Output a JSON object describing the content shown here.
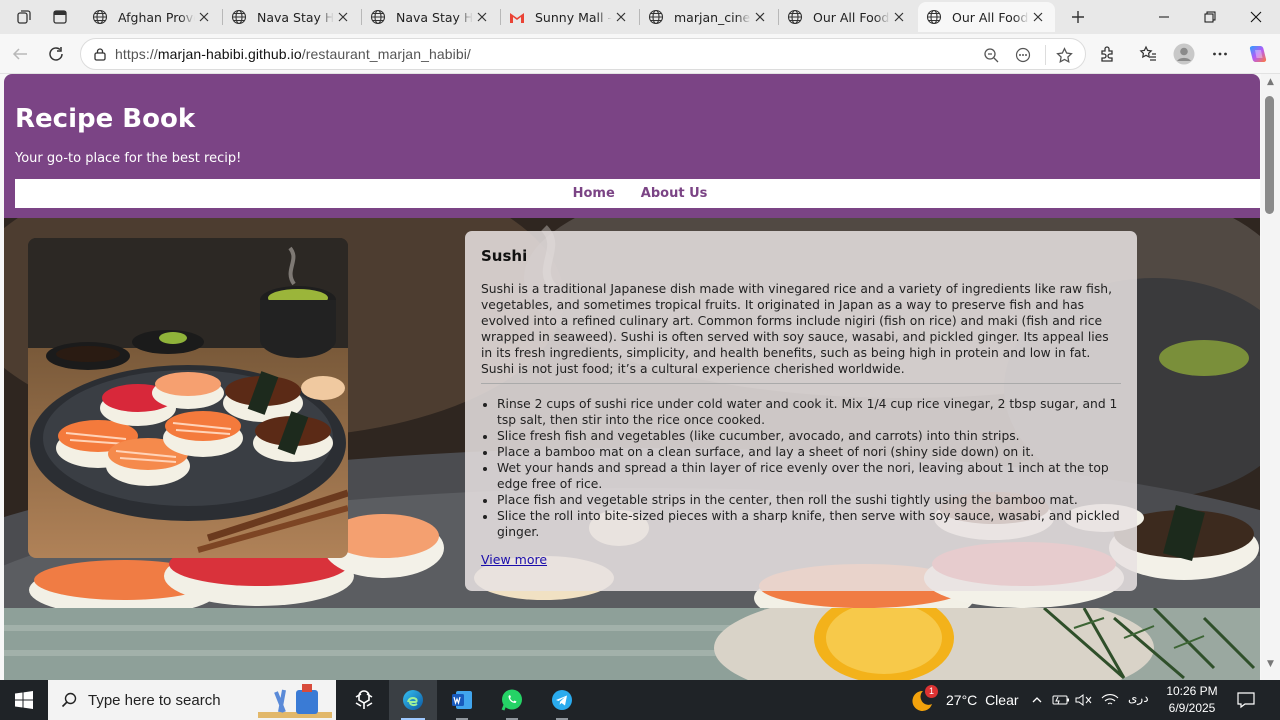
{
  "browser": {
    "tabs": [
      {
        "title": "Afghan Proverbs",
        "icon": "globe-icon",
        "active": false
      },
      {
        "title": "Nava Stay Hotel",
        "icon": "globe-icon",
        "active": false
      },
      {
        "title": "Nava Stay Hotel",
        "icon": "globe-icon",
        "active": false
      },
      {
        "title": "Sunny Mall - Y",
        "icon": "gmail-icon",
        "active": false
      },
      {
        "title": "marjan_cinema",
        "icon": "globe-icon",
        "active": false
      },
      {
        "title": "Our All Food",
        "icon": "globe-icon",
        "active": false
      },
      {
        "title": "Our All Food",
        "icon": "globe-icon",
        "active": true
      }
    ],
    "url_prefix": "https://",
    "url_host": "marjan-habibi.github.io",
    "url_path": "/restaurant_marjan_habibi/"
  },
  "site": {
    "title": "Recipe Book",
    "tagline": "Your go-to place for the best recip!",
    "nav": [
      "Home",
      "About Us"
    ]
  },
  "recipe": {
    "title": "Sushi",
    "description": "Sushi is a traditional Japanese dish made with vinegared rice and a variety of ingredients like raw fish, vegetables, and sometimes tropical fruits. It originated in Japan as a way to preserve fish and has evolved into a refined culinary art. Common forms include nigiri (fish on rice) and maki (fish and rice wrapped in seaweed). Sushi is often served with soy sauce, wasabi, and pickled ginger. Its appeal lies in its fresh ingredients, simplicity, and health benefits, such as being high in protein and low in fat. Sushi is not just food; it’s a cultural experience cherished worldwide.",
    "steps": [
      "Rinse 2 cups of sushi rice under cold water and cook it. Mix 1/4 cup rice vinegar, 2 tbsp sugar, and 1 tsp salt, then stir into the rice once cooked.",
      "Slice fresh fish and vegetables (like cucumber, avocado, and carrots) into thin strips.",
      "Place a bamboo mat on a clean surface, and lay a sheet of nori (shiny side down) on it.",
      "Wet your hands and spread a thin layer of rice evenly over the nori, leaving about 1 inch at the top edge free of rice.",
      "Place fish and vegetable strips in the center, then roll the sushi tightly using the bamboo mat.",
      "Slice the roll into bite-sized pieces with a sharp knife, then serve with soy sauce, wasabi, and pickled ginger."
    ],
    "view_more": "View more"
  },
  "taskbar": {
    "search_placeholder": "Type here to search",
    "weather_temp": "27°C",
    "weather_text": "Clear",
    "weather_badge": "1",
    "language": "دری",
    "time": "10:26 PM",
    "date": "6/9/2025"
  },
  "colors": {
    "header_purple": "#7b4485",
    "link_blue": "#1a0dab"
  }
}
